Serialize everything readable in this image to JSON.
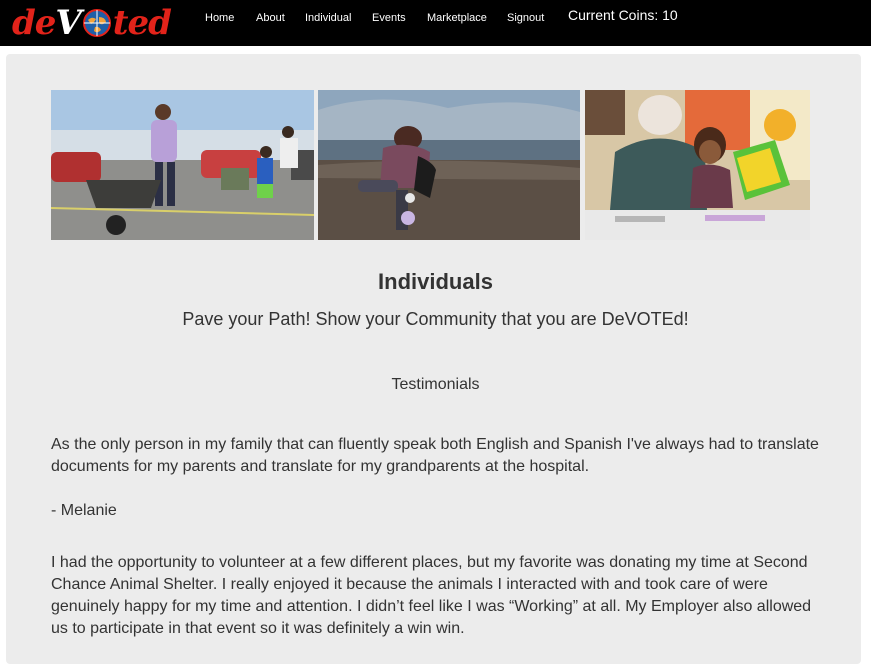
{
  "header": {
    "logo_text": "deVOTed",
    "nav": [
      {
        "label": "Home"
      },
      {
        "label": "About"
      },
      {
        "label": "Individual"
      },
      {
        "label": "Events"
      },
      {
        "label": "Marketplace"
      },
      {
        "label": "Signout"
      }
    ],
    "coins_label": "Current Coins: 10"
  },
  "main": {
    "title": "Individuals",
    "subtitle": "Pave your Path! Show your Community that you are DeVOTEd!",
    "section_heading": "Testimonials",
    "testimonials": [
      {
        "text": "As the only person in my family that can fluently speak both English and Spanish I've always had to translate documents for my parents and translate for my grandparents at the hospital.",
        "author": "- Melanie"
      },
      {
        "text": "I had the opportunity to volunteer at a few different places, but my favorite was donating my time at Second Chance Animal Shelter. I really enjoyed it because the animals I interacted with and took care of were genuinely happy for my time and attention. I didn’t feel like I was “Working” at all. My Employer also allowed us to participate in that event so it was definitely a win win."
      }
    ]
  },
  "colors": {
    "navbar_bg": "#000000",
    "logo_red": "#e2231a",
    "panel_bg": "#ececec",
    "text": "#333333"
  }
}
